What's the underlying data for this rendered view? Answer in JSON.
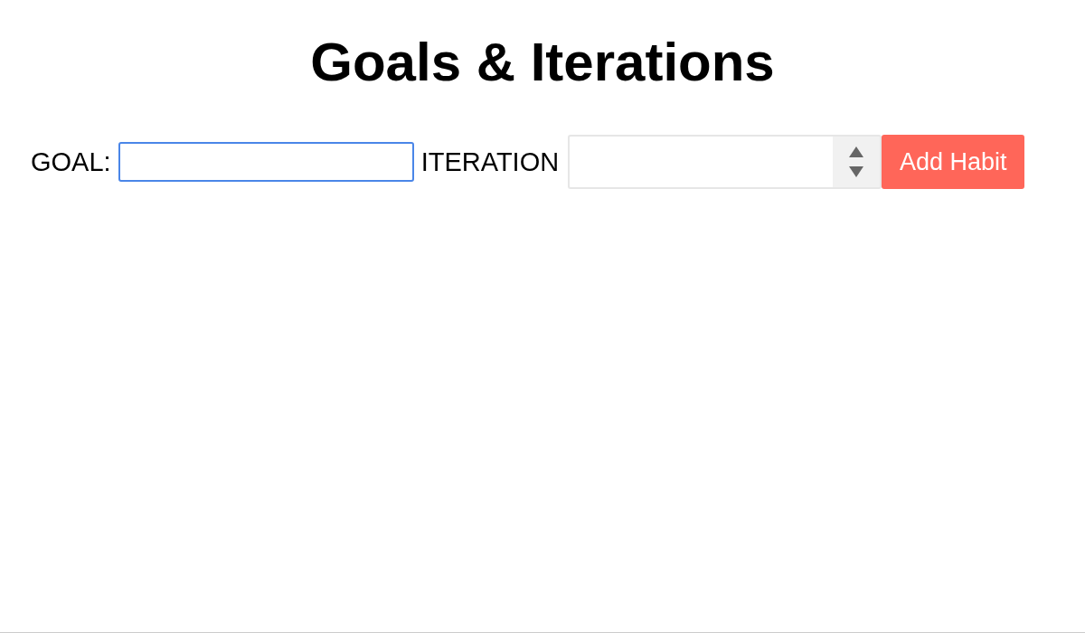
{
  "title": "Goals & Iterations",
  "form": {
    "goal_label": "GOAL:",
    "goal_field": {
      "focused": true
    },
    "iteration_label": "ITERATION",
    "submit_button": "Add Habit"
  }
}
